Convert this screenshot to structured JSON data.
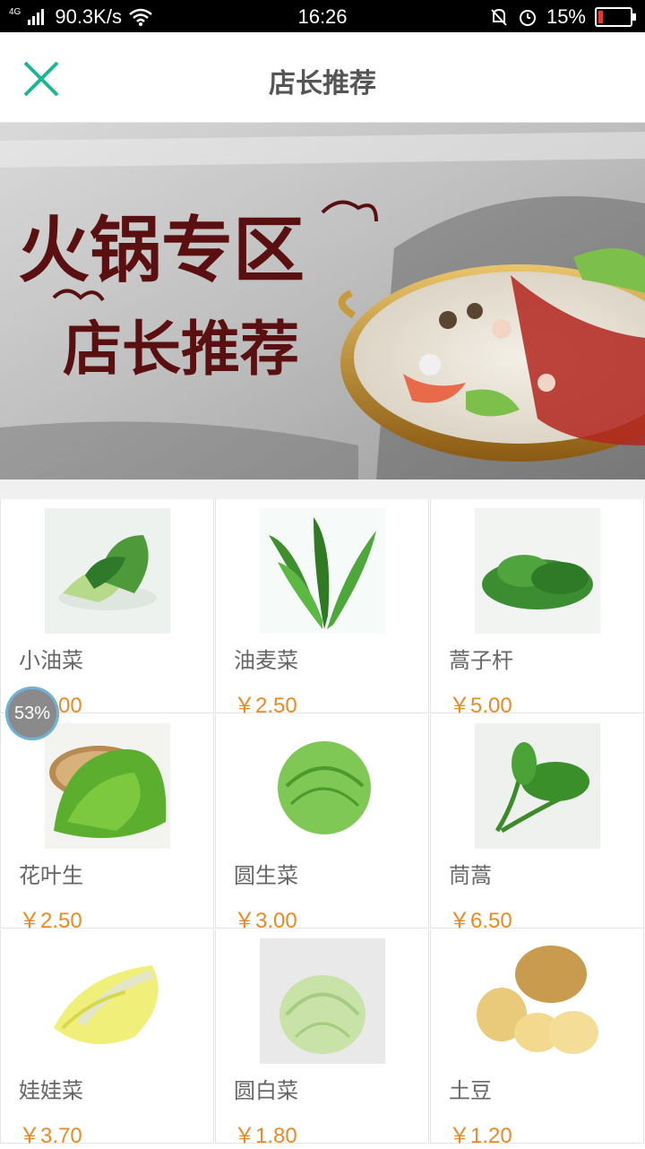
{
  "status_bar": {
    "network": "4G",
    "speed": "90.3K/s",
    "time": "16:26",
    "battery": "15%",
    "battery_level": 0.15
  },
  "header": {
    "title": "店长推荐",
    "close_icon": "close-icon"
  },
  "banner": {
    "line1": "火锅专区",
    "line2": "店长推荐"
  },
  "floating_badge": "53%",
  "products": [
    {
      "name": "小油菜",
      "price": "￥3.00"
    },
    {
      "name": "油麦菜",
      "price": "￥2.50"
    },
    {
      "name": "蒿子杆",
      "price": "￥5.00"
    },
    {
      "name": "花叶生",
      "price": "￥2.50"
    },
    {
      "name": "圆生菜",
      "price": "￥3.00"
    },
    {
      "name": "茼蒿",
      "price": "￥6.50"
    },
    {
      "name": "娃娃菜",
      "price": "￥3.70"
    },
    {
      "name": "圆白菜",
      "price": "￥1.80"
    },
    {
      "name": "土豆",
      "price": "￥1.20"
    }
  ],
  "colors": {
    "accent": "#19b891",
    "price": "#e98a22",
    "banner_text": "#5a1010"
  }
}
